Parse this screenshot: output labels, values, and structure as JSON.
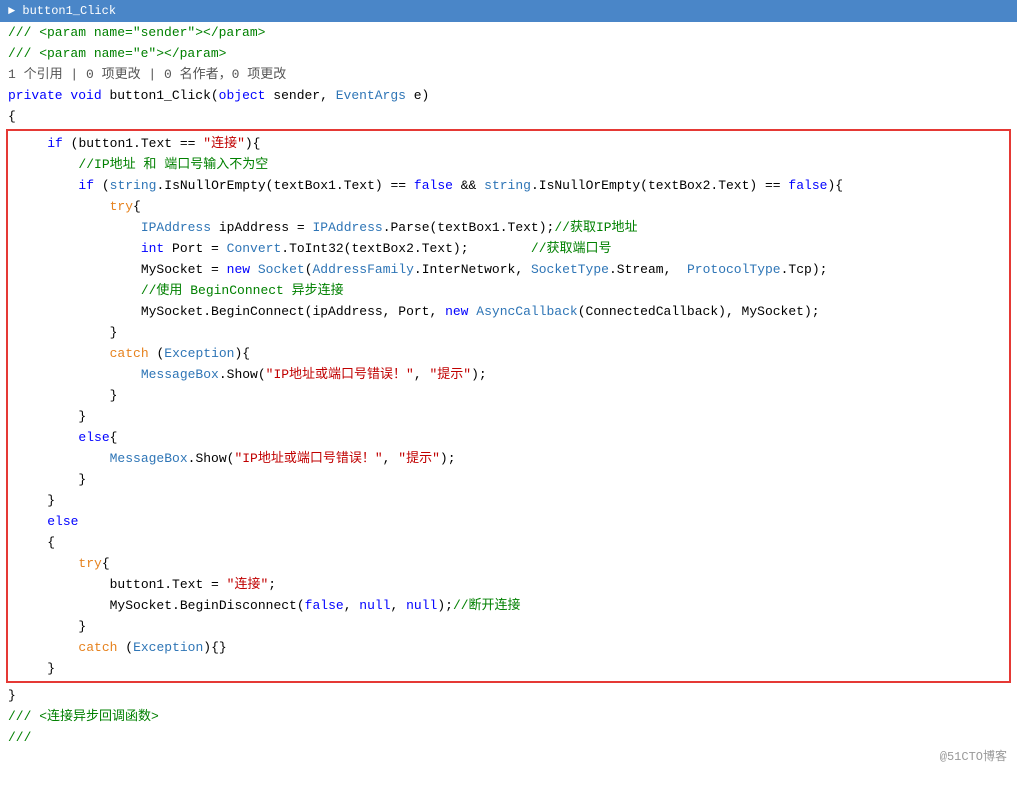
{
  "topbar": {
    "label": "button1_Click"
  },
  "lines": [
    {
      "id": "l1",
      "indent": 0,
      "content": "line_1"
    },
    {
      "id": "l2",
      "indent": 0,
      "content": "line_2"
    },
    {
      "id": "l3",
      "indent": 0,
      "content": "line_3"
    },
    {
      "id": "l4",
      "indent": 0,
      "content": "line_4"
    }
  ],
  "footer": {
    "credit": "@51CTO博客"
  },
  "colors": {
    "keyword": "#0000ff",
    "comment": "#008000",
    "string_red": "#c00000",
    "type_blue": "#2e75b6",
    "orange": "#e6821e",
    "red_border": "#e53935"
  }
}
